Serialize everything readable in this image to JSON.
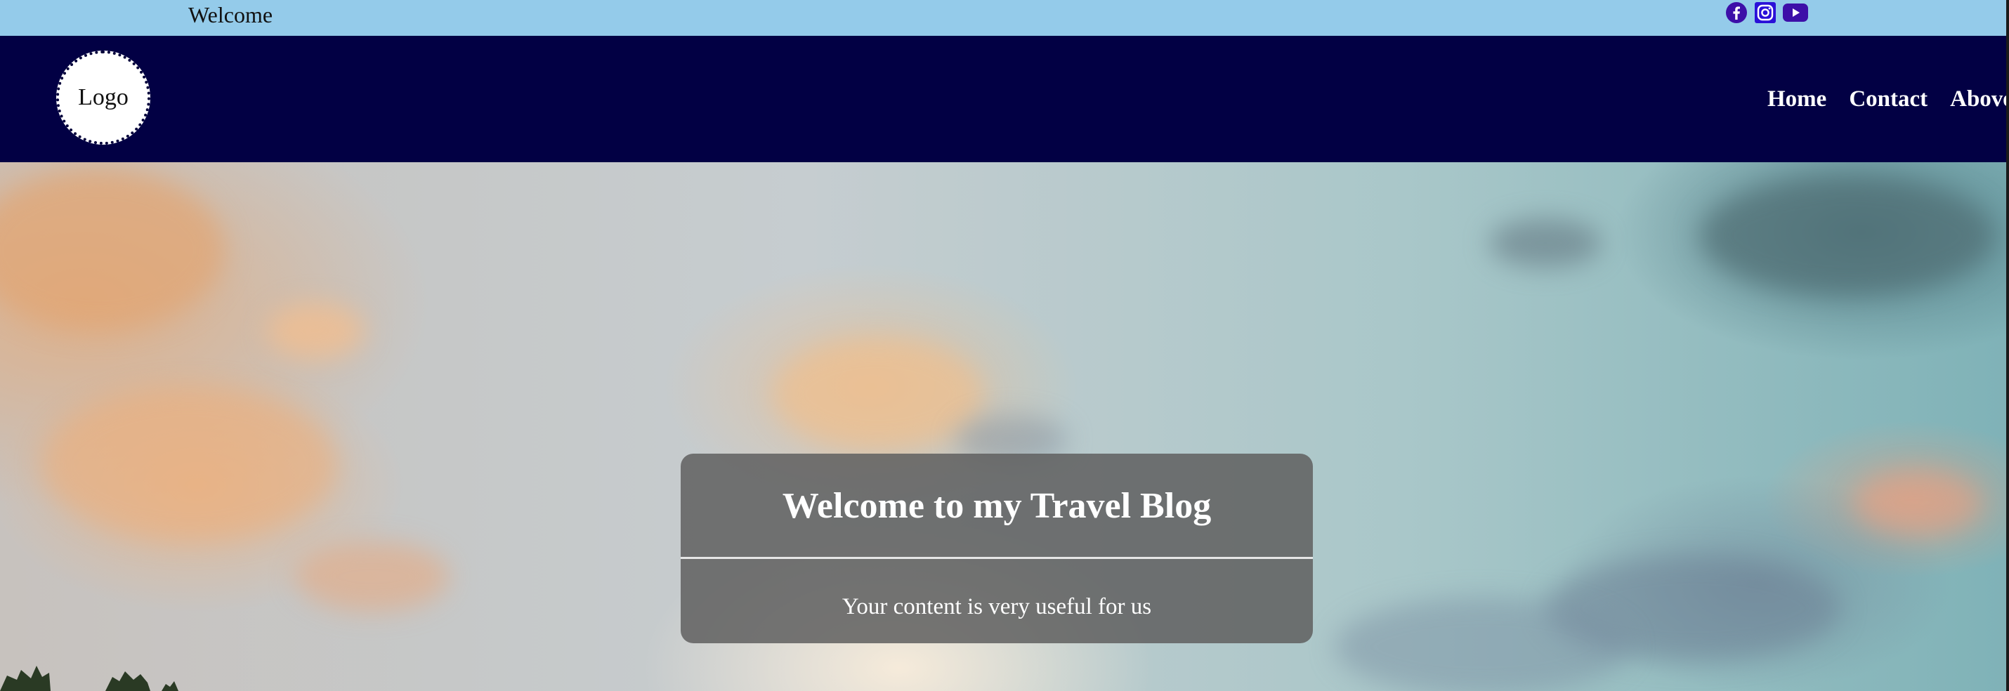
{
  "topbar": {
    "welcome_text": "Welcome",
    "social_icons": [
      "facebook-icon",
      "instagram-icon",
      "youtube-icon"
    ],
    "background_color": "#94cbea",
    "icon_color": "#3d0fa8"
  },
  "navbar": {
    "logo_text": "Logo",
    "background_color": "#020044",
    "links": [
      {
        "label": "Home"
      },
      {
        "label": "Contact"
      },
      {
        "label": "Above"
      }
    ]
  },
  "hero": {
    "title": "Welcome to my Travel Blog",
    "subtitle": "Your content is very useful for us"
  }
}
